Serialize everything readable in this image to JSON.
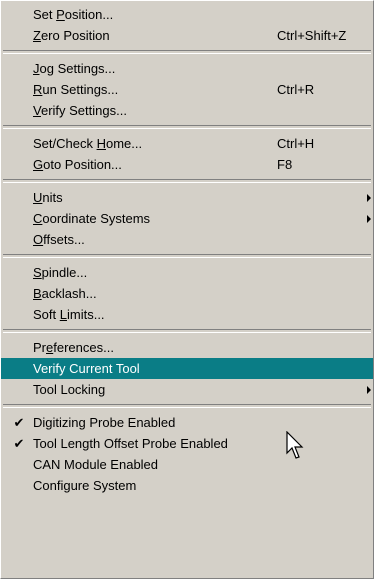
{
  "menu": {
    "groups": [
      {
        "items": [
          {
            "pre": "Set ",
            "key": "P",
            "post": "osition...",
            "shortcut": ""
          },
          {
            "pre": "",
            "key": "Z",
            "post": "ero Position",
            "shortcut": "Ctrl+Shift+Z"
          }
        ]
      },
      {
        "items": [
          {
            "pre": "",
            "key": "J",
            "post": "og Settings...",
            "shortcut": ""
          },
          {
            "pre": "",
            "key": "R",
            "post": "un Settings...",
            "shortcut": "Ctrl+R"
          },
          {
            "pre": "",
            "key": "V",
            "post": "erify Settings...",
            "shortcut": ""
          }
        ]
      },
      {
        "items": [
          {
            "pre": "Set/Check ",
            "key": "H",
            "post": "ome...",
            "shortcut": "Ctrl+H"
          },
          {
            "pre": "",
            "key": "G",
            "post": "oto Position...",
            "shortcut": "F8"
          }
        ]
      },
      {
        "items": [
          {
            "pre": "",
            "key": "U",
            "post": "nits",
            "shortcut": "",
            "submenu": true
          },
          {
            "pre": "",
            "key": "C",
            "post": "oordinate Systems",
            "shortcut": "",
            "submenu": true
          },
          {
            "pre": "",
            "key": "O",
            "post": "ffsets...",
            "shortcut": ""
          }
        ]
      },
      {
        "items": [
          {
            "pre": "",
            "key": "S",
            "post": "pindle...",
            "shortcut": ""
          },
          {
            "pre": "",
            "key": "B",
            "post": "acklash...",
            "shortcut": ""
          },
          {
            "pre": "Soft ",
            "key": "L",
            "post": "imits...",
            "shortcut": ""
          }
        ]
      },
      {
        "items": [
          {
            "pre": "Pr",
            "key": "e",
            "post": "ferences...",
            "shortcut": ""
          },
          {
            "pre": "Verify Current Tool",
            "key": "",
            "post": "",
            "shortcut": "",
            "highlighted": true
          },
          {
            "pre": "Tool Locking",
            "key": "",
            "post": "",
            "shortcut": "",
            "submenu": true
          }
        ]
      },
      {
        "items": [
          {
            "pre": "Digitizing Probe Enabled",
            "key": "",
            "post": "",
            "shortcut": "",
            "checked": true
          },
          {
            "pre": "Tool Length Offset Probe Enabled",
            "key": "",
            "post": "",
            "shortcut": "",
            "checked": true
          },
          {
            "pre": "CAN Module Enabled",
            "key": "",
            "post": "",
            "shortcut": ""
          },
          {
            "pre": "Configure System",
            "key": "",
            "post": "",
            "shortcut": ""
          }
        ]
      }
    ],
    "check_glyph": "✔",
    "highlight_color": "#0a7d86",
    "menu_background": "#d4d0c8"
  }
}
